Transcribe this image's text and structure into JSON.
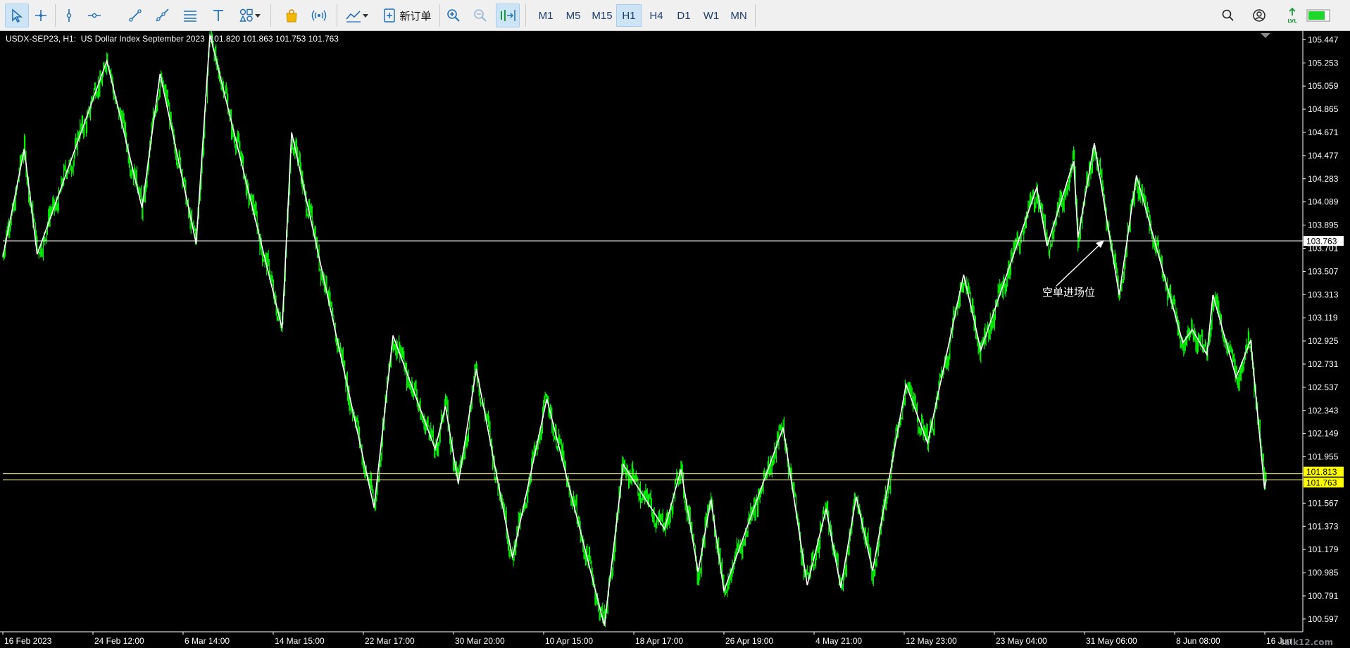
{
  "toolbar": {
    "tools": [
      {
        "name": "cursor-tool-button",
        "icon": "cursor-icon",
        "active": true
      },
      {
        "name": "crosshair-tool-button",
        "icon": "crosshair-icon"
      },
      {
        "name": "vertical-line-button",
        "icon": "vertical-line-icon"
      },
      {
        "name": "horizontal-line-button",
        "icon": "horizontal-line-icon"
      },
      {
        "name": "trendline-button",
        "icon": "trendline-icon"
      },
      {
        "name": "ray-button",
        "icon": "ray-icon"
      },
      {
        "name": "fibonacci-button",
        "icon": "fibonacci-icon"
      },
      {
        "name": "text-tool-button",
        "icon": "text-icon"
      },
      {
        "name": "shapes-button",
        "icon": "shapes-icon"
      }
    ],
    "new_order_label": "新订单",
    "timeframes": [
      "M1",
      "M5",
      "M15",
      "H1",
      "H4",
      "D1",
      "W1",
      "MN"
    ],
    "active_timeframe": "H1",
    "accent_color": "#1f6fbf"
  },
  "chart": {
    "symbol_info": "USDX-SEP23, H1:  US Dollar Index September 2023  101.820 101.863 101.753 101.763",
    "colors": {
      "background": "#000000",
      "candles": "#00ff00",
      "zigzag": "#ffffff",
      "price_line": "#ffff99",
      "axis_text": "#ffffff"
    },
    "annotation_text": "空单进场位",
    "watermark": "talk12.com",
    "price_labels": [
      "105.447",
      "105.253",
      "105.059",
      "104.865",
      "104.671",
      "104.477",
      "104.283",
      "104.089",
      "103.895",
      "103.701",
      "103.507",
      "103.313",
      "103.119",
      "102.925",
      "102.731",
      "102.537",
      "102.343",
      "102.149",
      "101.955",
      "101.567",
      "101.373",
      "101.179",
      "100.985",
      "100.791",
      "100.597"
    ],
    "badges": [
      {
        "value": "103.763",
        "type": "level"
      },
      {
        "value": "101.813",
        "type": "price"
      },
      {
        "value": "101.763",
        "type": "price"
      }
    ],
    "time_labels": [
      "16 Feb 2023",
      "24 Feb 12:00",
      "6 Mar 14:00",
      "14 Mar 15:00",
      "22 Mar 17:00",
      "30 Mar 20:00",
      "10 Apr 15:00",
      "18 Apr 17:00",
      "26 Apr 19:00",
      "4 May 21:00",
      "12 May 23:00",
      "23 May 04:00",
      "31 May 06:00",
      "8 Jun 08:00",
      "16 Jun"
    ]
  },
  "chart_data": {
    "type": "line",
    "y_range": [
      100.49,
      105.52
    ],
    "horizontal_levels": [
      103.763,
      101.813,
      101.763
    ],
    "zigzag": [
      {
        "i": 0,
        "y": 103.63
      },
      {
        "i": 25,
        "y": 104.53
      },
      {
        "i": 40,
        "y": 103.65
      },
      {
        "i": 121,
        "y": 105.27
      },
      {
        "i": 162,
        "y": 104.04
      },
      {
        "i": 183,
        "y": 105.16
      },
      {
        "i": 225,
        "y": 103.74
      },
      {
        "i": 241,
        "y": 105.49
      },
      {
        "i": 325,
        "y": 103.03
      },
      {
        "i": 336,
        "y": 104.67
      },
      {
        "i": 432,
        "y": 101.53
      },
      {
        "i": 454,
        "y": 102.97
      },
      {
        "i": 503,
        "y": 102.02
      },
      {
        "i": 515,
        "y": 102.38
      },
      {
        "i": 530,
        "y": 101.73
      },
      {
        "i": 551,
        "y": 102.69
      },
      {
        "i": 593,
        "y": 101.11
      },
      {
        "i": 633,
        "y": 102.44
      },
      {
        "i": 700,
        "y": 100.54
      },
      {
        "i": 722,
        "y": 101.89
      },
      {
        "i": 770,
        "y": 101.35
      },
      {
        "i": 789,
        "y": 101.85
      },
      {
        "i": 809,
        "y": 100.99
      },
      {
        "i": 824,
        "y": 101.6
      },
      {
        "i": 839,
        "y": 100.83
      },
      {
        "i": 908,
        "y": 102.2
      },
      {
        "i": 936,
        "y": 100.88
      },
      {
        "i": 958,
        "y": 101.52
      },
      {
        "i": 975,
        "y": 100.86
      },
      {
        "i": 993,
        "y": 101.62
      },
      {
        "i": 1012,
        "y": 101.0
      },
      {
        "i": 1051,
        "y": 102.56
      },
      {
        "i": 1076,
        "y": 102.07
      },
      {
        "i": 1118,
        "y": 103.48
      },
      {
        "i": 1138,
        "y": 102.85
      },
      {
        "i": 1203,
        "y": 104.21
      },
      {
        "i": 1215,
        "y": 103.72
      },
      {
        "i": 1246,
        "y": 104.43
      },
      {
        "i": 1251,
        "y": 103.79
      },
      {
        "i": 1270,
        "y": 104.58
      },
      {
        "i": 1299,
        "y": 103.31
      },
      {
        "i": 1319,
        "y": 104.31
      },
      {
        "i": 1373,
        "y": 102.91
      },
      {
        "i": 1384,
        "y": 103.02
      },
      {
        "i": 1401,
        "y": 102.81
      },
      {
        "i": 1408,
        "y": 103.31
      },
      {
        "i": 1435,
        "y": 102.62
      },
      {
        "i": 1452,
        "y": 102.93
      },
      {
        "i": 1468,
        "y": 101.69
      },
      {
        "i": 1470,
        "y": 101.76
      }
    ]
  }
}
